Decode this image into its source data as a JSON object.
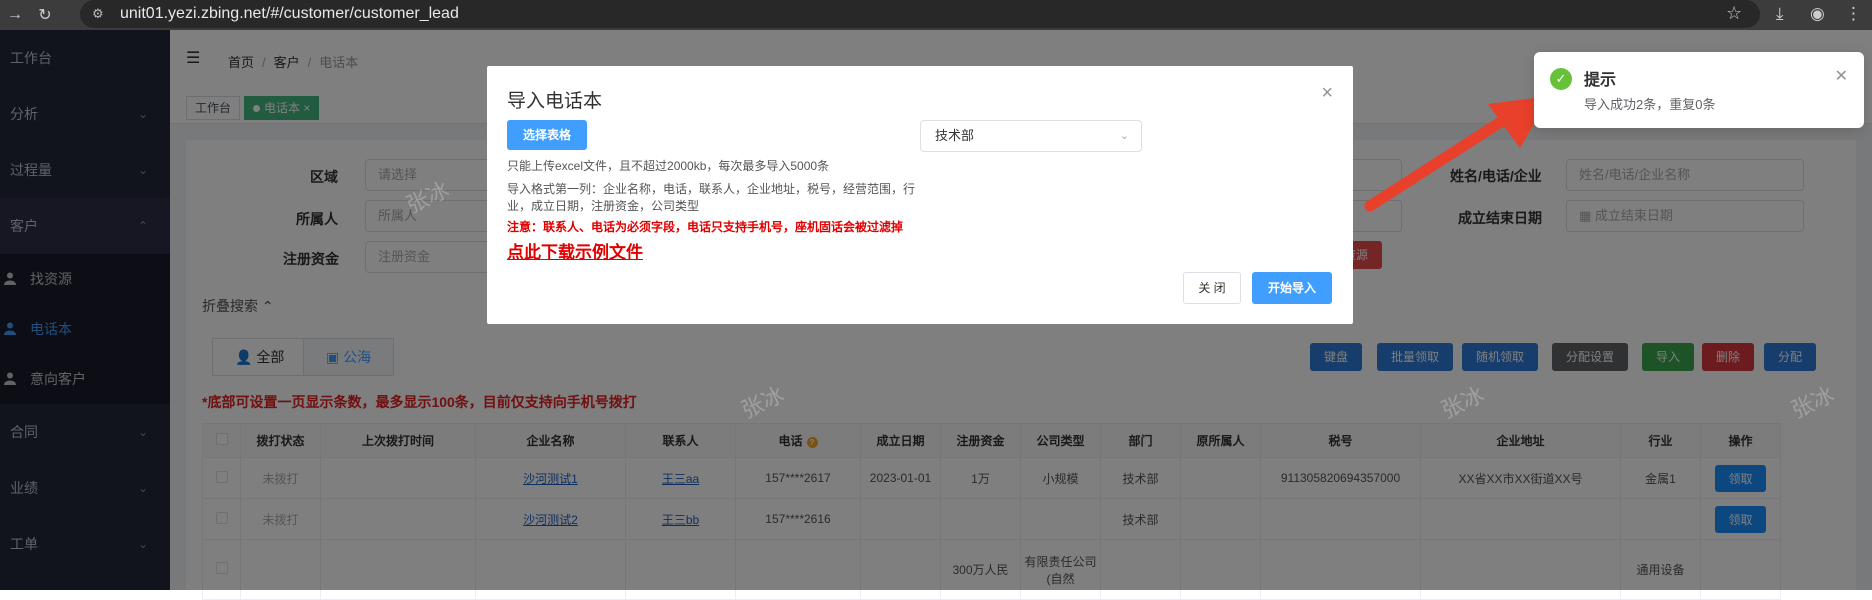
{
  "browser": {
    "url": "unit01.yezi.zbing.net/#/customer/customer_lead"
  },
  "sidebar": {
    "items": [
      {
        "label": "工作台"
      },
      {
        "label": "分析"
      },
      {
        "label": "过程量"
      },
      {
        "label": "客户"
      },
      {
        "label": "找资源"
      },
      {
        "label": "电话本"
      },
      {
        "label": "意向客户"
      },
      {
        "label": "合同"
      },
      {
        "label": "业绩"
      },
      {
        "label": "工单"
      }
    ]
  },
  "breadcrumb": {
    "home": "首页",
    "customer": "客户",
    "current": "电话本"
  },
  "tags": {
    "workbench": "工作台",
    "phonebook": "电话本"
  },
  "filters": {
    "region_label": "区域",
    "region_placeholder": "请选择",
    "owner_label": "所属人",
    "owner_placeholder": "所属人",
    "capital_label": "注册资金",
    "capital_placeholder": "注册资金",
    "name_label": "姓名/电话/企业",
    "name_placeholder": "姓名/电话/企业名称",
    "end_label": "成立结束日期",
    "end_placeholder": "成立结束日期",
    "resource_btn": "资源",
    "fold": "折叠搜索"
  },
  "tabs": {
    "all": "全部",
    "sea": "公海"
  },
  "actions": {
    "b1": "键盘",
    "b2": "批量领取",
    "b3": "随机领取",
    "b4": "分配设置",
    "b5": "导入",
    "b6": "删除",
    "b7": "分配"
  },
  "notice": "*底部可设置一页显示条数，最多显示100条，目前仅支持向手机号拨打",
  "table": {
    "headers": [
      "",
      "拨打状态",
      "上次拨打时间",
      "企业名称",
      "联系人",
      "电话",
      "成立日期",
      "注册资金",
      "公司类型",
      "部门",
      "原所属人",
      "税号",
      "企业地址",
      "行业",
      "操作"
    ],
    "rows": [
      [
        "",
        "未拨打",
        "",
        "沙河测试1",
        "王三aa",
        "157****2617",
        "2023-01-01",
        "1万",
        "小规模",
        "技术部",
        "",
        "911305820694357000",
        "XX省XX市XX街道XX号",
        "金属1",
        "领取"
      ],
      [
        "",
        "未拨打",
        "",
        "沙河测试2",
        "王三bb",
        "157****2616",
        "",
        "",
        "",
        "技术部",
        "",
        "",
        "",
        "",
        "领取"
      ],
      [
        "",
        "",
        "",
        "",
        "",
        "",
        "",
        "300万人民",
        "有限责任公司(自然",
        "",
        "",
        "",
        "",
        "通用设备",
        ""
      ]
    ]
  },
  "dialog": {
    "title": "导入电话本",
    "pick_btn": "选择表格",
    "size_note": "只能上传excel文件，且不超过2000kb，每次最多导入5000条",
    "format_note_1": "导入格式第一列：企业名称，电话，联系人，企业地址，税号，经营范围，行",
    "format_note_2": "业，成立日期，注册资金，公司类型",
    "warn": "注意：联系人、电话为必须字段，电话只支持手机号，座机固话会被过滤掉",
    "download_link": "点此下载示例文件",
    "dept": "技术部",
    "close_btn": "关 闭",
    "start_btn": "开始导入"
  },
  "notification": {
    "title": "提示",
    "message": "导入成功2条，重复0条"
  },
  "watermark": "张冰"
}
